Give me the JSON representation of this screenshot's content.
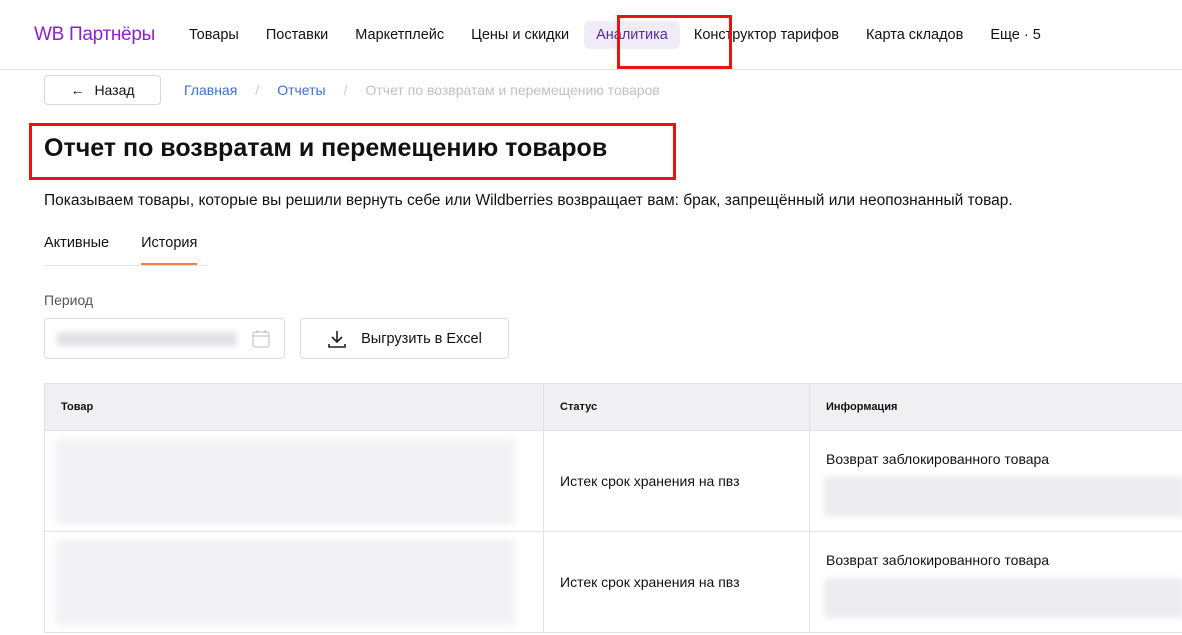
{
  "header": {
    "logo": "WB Партнёры",
    "nav": [
      "Товары",
      "Поставки",
      "Маркетплейс",
      "Цены и скидки",
      "Аналитика",
      "Конструктор тарифов",
      "Карта складов",
      "Еще · 5"
    ]
  },
  "breadcrumb": {
    "back": "Назад",
    "items": [
      "Главная",
      "Отчеты",
      "Отчет по возвратам и перемещению товаров"
    ]
  },
  "title": "Отчет по возвратам и перемещению товаров",
  "description": "Показываем товары, которые вы решили вернуть себе или Wildberries возвращает вам: брак, запрещённый или неопознанный товар.",
  "tabs": [
    "Активные",
    "История"
  ],
  "filter": {
    "period_label": "Период",
    "export": "Выгрузить в Excel"
  },
  "table": {
    "columns": [
      "Товар",
      "Статус",
      "Информация"
    ],
    "rows": [
      {
        "status": "Истек срок хранения на пвз",
        "info": "Возврат заблокированного товара"
      },
      {
        "status": "Истек срок хранения на пвз",
        "info": "Возврат заблокированного товара"
      }
    ]
  },
  "colors": {
    "brand": "#8b1fd8",
    "link": "#3b6fd8",
    "highlight": "#ee1111"
  }
}
